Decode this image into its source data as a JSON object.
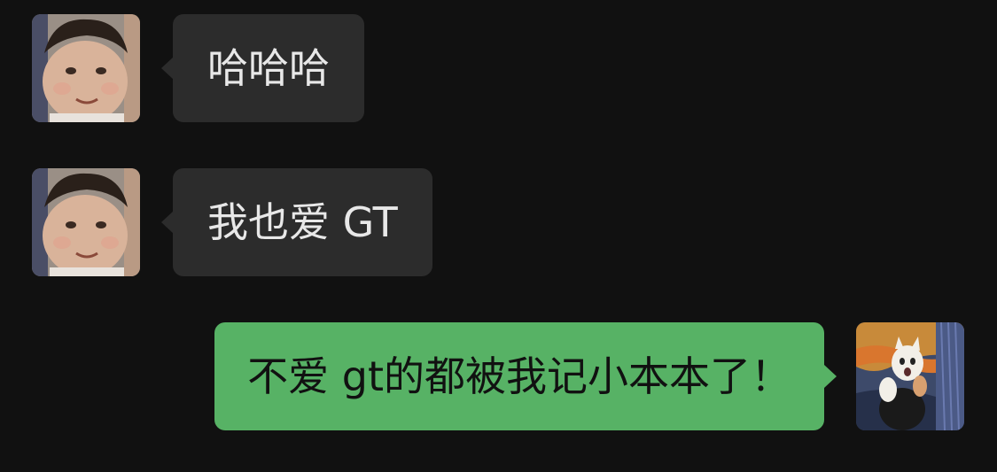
{
  "chat": {
    "messages": [
      {
        "direction": "incoming",
        "sender_avatar": "child-avatar",
        "text": "哈哈哈"
      },
      {
        "direction": "incoming",
        "sender_avatar": "child-avatar",
        "text": "我也爱 GT"
      },
      {
        "direction": "outgoing",
        "sender_avatar": "cat-avatar",
        "text": "不爱 gt的都被我记小本本了！"
      }
    ]
  },
  "colors": {
    "background": "#111111",
    "incoming_bubble": "#2c2c2c",
    "incoming_text": "#e8e8e8",
    "outgoing_bubble": "#57b265",
    "outgoing_text": "#111111"
  }
}
